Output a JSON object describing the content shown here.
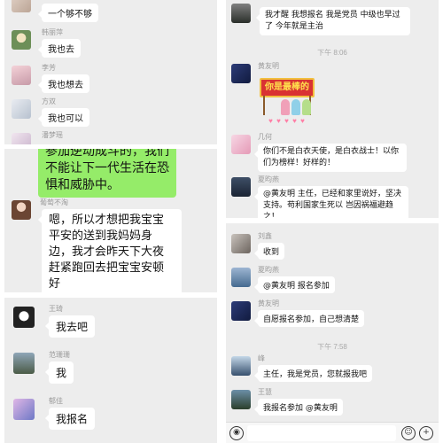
{
  "panel1": {
    "messages": [
      {
        "name": "",
        "text": "一个够不够"
      },
      {
        "name": "韩丽萍",
        "text": "我也去"
      },
      {
        "name": "李芳",
        "text": "我也想去"
      },
      {
        "name": "方双",
        "text": "我也可以"
      },
      {
        "name": "潘梦瑶",
        "text": ""
      }
    ]
  },
  "panel2": {
    "green_text": "参加逆动成斗的，我们不能让下一代生活在恐惧和威胁中。",
    "messages": [
      {
        "name": "葡萄不淘",
        "text": "嗯，所以才想把我宝宝平安的送到我妈妈身边，我才会昨天下大夜赶紧跑回去把宝宝安顿好"
      }
    ]
  },
  "panel3": {
    "messages": [
      {
        "name": "王琦",
        "text": "我去吧"
      },
      {
        "name": "范珊珊",
        "text": "我"
      },
      {
        "name": "郁佳",
        "text": "我报名"
      }
    ]
  },
  "panel4": {
    "top_message": {
      "text": "我才醒 我想报名 我是党员 中级也早过了 今年就是主治"
    },
    "time1": "下午 8:06",
    "sticker_sender": "黄友明",
    "sticker_text": "你是最棒的",
    "messages": [
      {
        "name": "几何",
        "text": "你们不是白衣天使，是白衣战士！以你们为榜样！好样的！"
      },
      {
        "name": "夏昀燕",
        "text": "@黄友明 主任，已经和家里说好，坚决支持。苟利国家生死以 岂因祸福避趋之！"
      }
    ]
  },
  "panel5": {
    "messages": [
      {
        "name": "刘鑫",
        "text": "收到"
      },
      {
        "name": "夏昀燕",
        "text": "@黄友明 报名参加"
      },
      {
        "name": "黄友明",
        "text": "自愿报名参加，自己想清楚"
      }
    ],
    "time2": "下午 7:58",
    "messages2": [
      {
        "name": "峰",
        "text": "主任，我是党员，您就报我吧"
      },
      {
        "name": "王慧",
        "text": "我报名参加 @黄友明"
      }
    ],
    "input": {
      "voice_icon": "voice-icon",
      "emoji_icon": "emoji-icon",
      "plus_icon": "plus-icon"
    }
  }
}
